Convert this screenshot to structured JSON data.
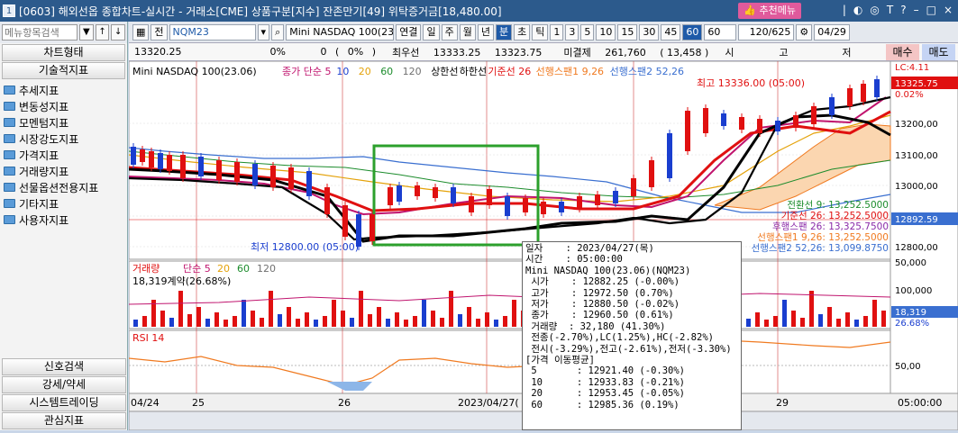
{
  "window": {
    "number": "1",
    "title": "[0603] 해외선옵 종합차트-실시간 - 거래소[CME] 상품구분[지수] 잔존만기[49] 위탁증거금[18,480.00]",
    "recommend_label": "추천메뉴",
    "icons": [
      "|",
      "◐",
      "◎",
      "T",
      "?",
      "–",
      "□",
      "×"
    ]
  },
  "left": {
    "search_placeholder": "메뉴항목검색",
    "chart_type_label": "차트형태",
    "tech_label": "기술적지표",
    "items": [
      "추세지표",
      "변동성지표",
      "모멘텀지표",
      "시장강도지표",
      "가격지표",
      "거래량지표",
      "선물옵션전용지표",
      "기타지표",
      "사용자지표"
    ],
    "bottom": [
      "신호검색",
      "강세/약세",
      "시스템트레이딩",
      "관심지표"
    ]
  },
  "toolbar": {
    "mode": "전",
    "code": "NQM23",
    "name": "Mini NASDAQ 100(23.0",
    "link": "연결",
    "periods": [
      "일",
      "주",
      "월",
      "년",
      "분",
      "초",
      "틱"
    ],
    "minutes": [
      "1",
      "3",
      "5",
      "10",
      "15",
      "30",
      "45",
      "60"
    ],
    "selected_period": "분",
    "selected_minute": "60",
    "interval": "60",
    "count": "120/625",
    "date": "04/29"
  },
  "infobar": {
    "price": "13320.25",
    "chg_pct": "0%",
    "zero": "0",
    "zero_pct": "0%",
    "high_label": "최우선",
    "high1": "13333.25",
    "high2": "13323.75",
    "unexec_label": "미결제",
    "unexec": "261,760",
    "unexec_chg": "( 13,458 )",
    "status": "시",
    "status2": "고",
    "status3": "저",
    "buy": "매수",
    "sell": "매도"
  },
  "chart": {
    "legend_title": "Mini NASDAQ 100(23.06)",
    "legend_items": [
      {
        "label": "종가 단순 5",
        "color": "#c0146e"
      },
      {
        "label": "10",
        "color": "#1a3ecf"
      },
      {
        "label": "20",
        "color": "#e4a20a"
      },
      {
        "label": "60",
        "color": "#1c8c2c"
      },
      {
        "label": "120",
        "color": "#707070"
      },
      {
        "label": "상한선",
        "color": "#000000"
      },
      {
        "label": "하한선",
        "color": "#000000"
      },
      {
        "label": "기준선 26",
        "color": "#e01010"
      },
      {
        "label": "선행스팬1 9,26",
        "color": "#f07a20"
      },
      {
        "label": "선행스팬2 52,26",
        "color": "#3a6fd0"
      }
    ],
    "high_label": "최고 13336.00 (05:00)",
    "low_label": "최저 12800.00 (05:00)",
    "lc_label": "LC:4.11",
    "price_tag": "13325.75",
    "pct_tag": "0.02%",
    "price_ticks": [
      "13200,00",
      "13100,00",
      "13000,00",
      "12900,00",
      "12800,00"
    ],
    "cur_price": "12892.59",
    "right_legends": [
      {
        "label": "전환선 9: 13,252.5000",
        "color": "#1c8c2c"
      },
      {
        "label": "기준선 26: 13,252.5000",
        "color": "#e01010"
      },
      {
        "label": "후행스팬 26: 13,325.7500",
        "color": "#8a2aa8"
      },
      {
        "label": "선행스팬1 9,26: 13,252.5000",
        "color": "#f07a20"
      },
      {
        "label": "선행스팬2 52,26: 13,099.8750",
        "color": "#3a6fd0"
      }
    ],
    "volume_legend": {
      "title": "거래량",
      "items": [
        {
          "label": "단순 5",
          "color": "#c0146e"
        },
        {
          "label": "20",
          "color": "#e4a20a"
        },
        {
          "label": "60",
          "color": "#1c8c2c"
        },
        {
          "label": "120",
          "color": "#707070"
        }
      ],
      "contracts": "18,319계약(26.68%)"
    },
    "volume_ticks": [
      "100,000",
      "50,000"
    ],
    "volume_tag": "18,319",
    "volume_pct": "26.68%",
    "rsi_title": "RSI 14",
    "rsi_tick": "50,00",
    "x_labels": [
      "04/24",
      "25",
      "26",
      "2023/04/27(",
      "29"
    ],
    "x_right": "05:00:00"
  },
  "tooltip": [
    "일자    : 2023/04/27(목)",
    "시간    : 05:00:00",
    "Mini NASDAQ 100(23.06)(NQM23)",
    " 시가    : 12882.25 (-0.00%)",
    " 고가    : 12972.50 (0.70%)",
    " 저가    : 12880.50 (-0.02%)",
    " 종가    : 12960.50 (0.61%)",
    " 거래량  : 32,180 (41.30%)",
    " 전종(-2.70%),LC(1.25%),HC(-2.82%)",
    " 전시(-3.29%),전고(-2.61%),전저(-3.30%)",
    "[가격 이동평균]",
    " 5       : 12921.40 (-0.30%)",
    " 10      : 12933.83 (-0.21%)",
    " 20      : 12953.45 (-0.05%)",
    " 60      : 12985.36 (0.19%)"
  ],
  "colors": {
    "up": "#e01010",
    "down": "#1a3ecf",
    "highlight": "#2ca02c"
  }
}
